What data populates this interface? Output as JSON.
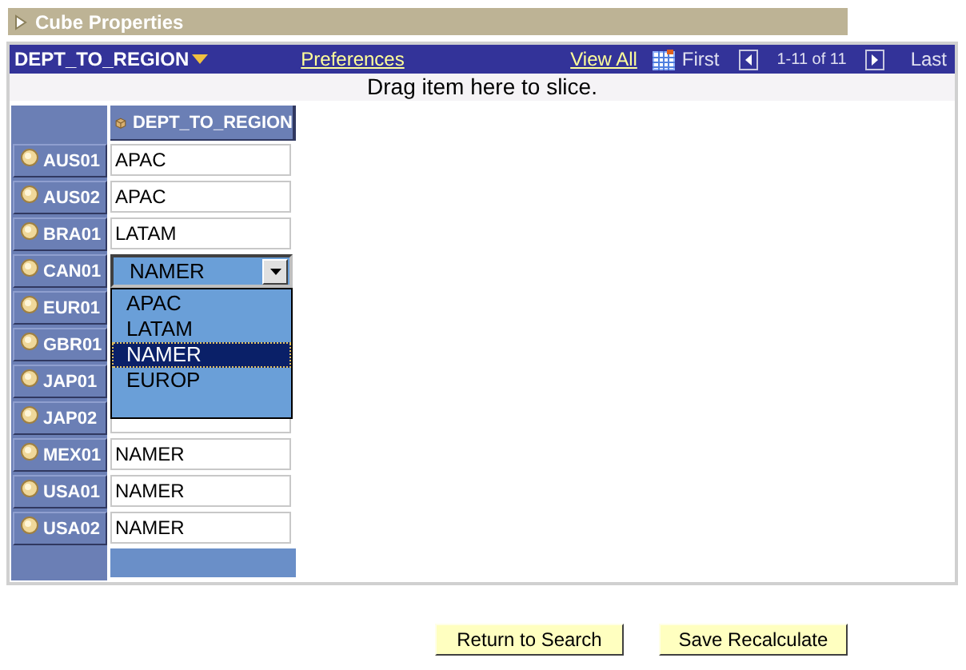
{
  "section": {
    "title": "Cube Properties",
    "expanded": false
  },
  "grid": {
    "dimension": "DEPT_TO_REGION",
    "preferences": "Preferences",
    "view_all": "View All",
    "first": "First",
    "range": "1-11 of 11",
    "last": "Last",
    "slice_hint": "Drag item here to slice.",
    "column_header": "DEPT_TO_REGION",
    "rows": [
      {
        "label": "AUS01",
        "kind": "text",
        "value": "APAC"
      },
      {
        "label": "AUS02",
        "kind": "text",
        "value": "APAC"
      },
      {
        "label": "BRA01",
        "kind": "text",
        "value": "LATAM"
      },
      {
        "label": "CAN01",
        "kind": "select",
        "value": "NAMER",
        "options": [
          {
            "label": "APAC",
            "selected": false
          },
          {
            "label": "LATAM",
            "selected": false
          },
          {
            "label": "NAMER",
            "selected": true
          },
          {
            "label": "EUROP",
            "selected": false
          }
        ]
      },
      {
        "label": "EUR01",
        "kind": "hidden"
      },
      {
        "label": "GBR01",
        "kind": "hidden"
      },
      {
        "label": "JAP01",
        "kind": "hidden"
      },
      {
        "label": "JAP02",
        "kind": "covered"
      },
      {
        "label": "MEX01",
        "kind": "text",
        "value": "NAMER"
      },
      {
        "label": "USA01",
        "kind": "text",
        "value": "NAMER"
      },
      {
        "label": "USA02",
        "kind": "text",
        "value": "NAMER"
      }
    ]
  },
  "buttons": [
    "Return to Search",
    "Save Recalculate"
  ]
}
